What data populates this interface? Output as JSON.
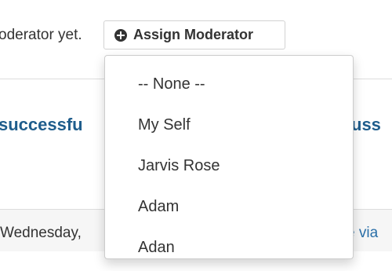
{
  "status": {
    "no_moderator_text": "oderator yet."
  },
  "assign_button": {
    "label": "Assign Moderator",
    "icon": "plus-circle-icon"
  },
  "post": {
    "title_left": "successfu",
    "title_right": "uss"
  },
  "footer": {
    "date_text": "Wednesday,",
    "via_text": "e via"
  },
  "dropdown": {
    "items": [
      {
        "label": "-- None --"
      },
      {
        "label": "My Self"
      },
      {
        "label": "Jarvis Rose"
      },
      {
        "label": "Adam"
      },
      {
        "label": "Adan"
      }
    ]
  },
  "colors": {
    "link_blue": "#1f5d8c",
    "border": "#cccccc"
  }
}
